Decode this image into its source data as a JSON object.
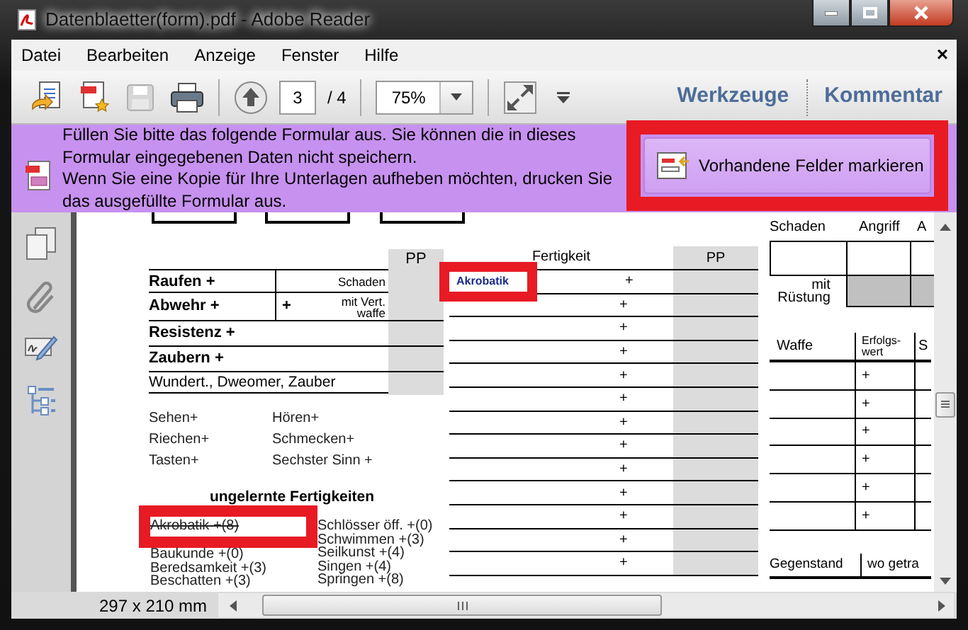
{
  "window": {
    "title": "Datenblaetter(form).pdf - Adobe Reader"
  },
  "menu": [
    {
      "label": "Datei"
    },
    {
      "label": "Bearbeiten"
    },
    {
      "label": "Anzeige"
    },
    {
      "label": "Fenster"
    },
    {
      "label": "Hilfe"
    }
  ],
  "menu_close": "×",
  "toolbar": {
    "save_disabled": true,
    "page": "3",
    "page_total": "/ 4",
    "zoom": "75%",
    "tools": "Werkzeuge",
    "comment": "Kommentar"
  },
  "form_bar": {
    "paragraphs": [
      "Füllen Sie bitte das folgende Formular aus. Sie können die in dieses Formular eingegebenen Daten nicht speichern.",
      "Wenn Sie eine Kopie für Ihre Unterlagen aufheben möchten, drucken Sie das ausgefüllte Formular aus."
    ],
    "button": {
      "label": "Vorhandene Felder markieren",
      "highlighted": true
    }
  },
  "document": {
    "combat": {
      "column_header": "PP",
      "rows": [
        {
          "label": "Raufen +",
          "kind": "split",
          "note": "Schaden"
        },
        {
          "label": "Abwehr +",
          "kind": "split",
          "plus": "+",
          "note": "mit Vert.\nwaffe"
        },
        {
          "label": "Resistenz +",
          "kind": "wide"
        },
        {
          "label": "Zaubern +",
          "kind": "wide"
        },
        {
          "label": "Wundert., Dweomer, Zauber",
          "kind": "plain"
        }
      ]
    },
    "senses": [
      "Sehen+",
      "Hören+",
      "Riechen+",
      "Schmecken+",
      "Tasten+",
      "Sechster Sinn +"
    ],
    "untrained": {
      "title": "ungelernte Fertigkeiten",
      "left": [
        {
          "label": "Akrobatik +(8)",
          "highlighted": true,
          "struck": true
        },
        {
          "label": "Baukunde +(0)",
          "highlighted": false,
          "struck": false
        },
        {
          "label": "Beredsamkeit +(3)",
          "highlighted": false,
          "struck": false
        },
        {
          "label": "Beschatten +(3)",
          "highlighted": false,
          "struck": false
        }
      ],
      "right": [
        "Schlösser öff. +(0)",
        "Schwimmen +(3)",
        "Seilkunst +(4)",
        "Singen +(4)",
        "Springen +(8)"
      ]
    },
    "skills": {
      "header": "Fertigkeit",
      "pp_header": "PP",
      "rows": [
        {
          "field": "Akrobatik",
          "plus": "+",
          "highlighted": true
        },
        {
          "plus": "+",
          "highlighted": false
        },
        {
          "plus": "+",
          "highlighted": false
        },
        {
          "plus": "+",
          "highlighted": false
        },
        {
          "plus": "+",
          "highlighted": false
        },
        {
          "plus": "+",
          "highlighted": false
        },
        {
          "plus": "+",
          "highlighted": false
        },
        {
          "plus": "+",
          "highlighted": false
        },
        {
          "plus": "+",
          "highlighted": false
        },
        {
          "plus": "+",
          "highlighted": false
        },
        {
          "plus": "+",
          "highlighted": false
        },
        {
          "plus": "+",
          "highlighted": false
        },
        {
          "plus": "+",
          "highlighted": false
        }
      ]
    },
    "bonus": {
      "headers": [
        "Schaden",
        "Angriff",
        "A"
      ],
      "armor_label": "mit\nRüstung"
    },
    "weapons": {
      "headers": [
        "Waffe",
        "Erfolgs-\nwert",
        "S"
      ],
      "rows": [
        "+",
        "+",
        "+",
        "+",
        "+",
        "+"
      ]
    },
    "items": {
      "headers": [
        "Gegenstand",
        "wo getra"
      ]
    }
  },
  "status": {
    "page_size": "297 x 210 mm"
  }
}
